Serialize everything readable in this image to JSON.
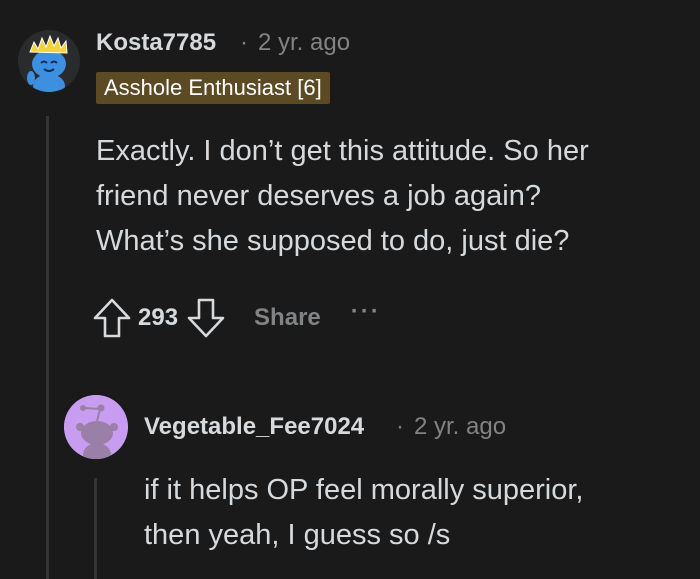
{
  "colors": {
    "background": "#1a1a1b",
    "text_primary": "#d7dadc",
    "text_muted": "#818384",
    "flair_bg": "#5c4a24",
    "thread_line": "#343536"
  },
  "comment": {
    "username": "Kosta7785",
    "separator": "·",
    "time": "2 yr. ago",
    "flair": "Asshole Enthusiast [6]",
    "body_lines": [
      "Exactly. I don’t get this attitude. So her",
      "friend never deserves a job again?",
      "What’s she supposed to do, just die?"
    ],
    "votes": "293",
    "share_label": "Share",
    "more_label": "···",
    "icons": {
      "upvote": "upvote-arrow-icon",
      "downvote": "downvote-arrow-icon",
      "more": "more-options-icon"
    }
  },
  "reply": {
    "username": "Vegetable_Fee7024",
    "separator": "·",
    "time": "2 yr. ago",
    "body_lines": [
      "if it helps OP feel morally superior,",
      "then yeah, I guess so /s"
    ]
  }
}
